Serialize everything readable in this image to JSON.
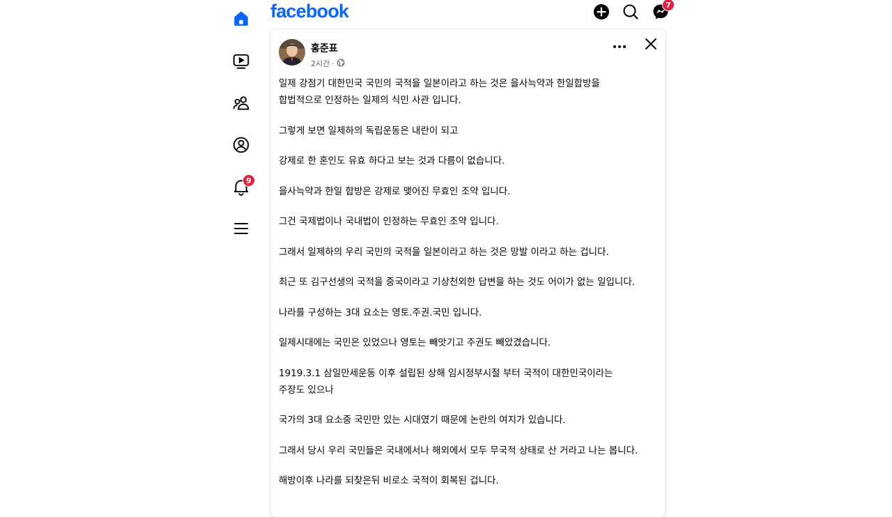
{
  "colors": {
    "brand": "#0866ff",
    "badge": "#e41e3f",
    "muted": "#65676b"
  },
  "topbar": {
    "logo": "facebook",
    "messenger_badge": "7",
    "icons": [
      "add-icon",
      "search-icon",
      "messenger-icon"
    ]
  },
  "rail": {
    "items": [
      {
        "icon": "home-icon",
        "active": true
      },
      {
        "icon": "video-icon",
        "active": false
      },
      {
        "icon": "friends-icon",
        "active": false
      },
      {
        "icon": "profile-icon",
        "active": false
      },
      {
        "icon": "bell-icon",
        "active": false,
        "badge": "9"
      },
      {
        "icon": "menu-icon",
        "active": false
      }
    ]
  },
  "post": {
    "author": "홍준표",
    "time": "2시간",
    "separator": "·",
    "audience_icon": "globe-icon",
    "paragraphs": [
      "일제 강점기 대한민국 국민의 국적을 일본이라고 하는 것은 을사늑약과 한일합방을\n합법적으로 인정하는 일제의 식민 사관 입니다.",
      "그렇게 보면 일제하의 독립운동은 내란이 되고",
      "강제로 한 혼인도  유효 하다고 보는 것과 다름이 없습니다.",
      "을사늑약과 한일 합방은 강제로 맺어진 무효인 조약 입니다.",
      "그건 국제법이나 국내법이 인정하는 무효인 조약 입니다.",
      "그래서 일제하의 우리 국민의 국적을 일본이라고 하는 것은 망발 이라고 하는 겁니다.",
      "최근 또 김구선생의 국적을 중국이라고 기상천외한 답변을 하는 것도 어이가 없는 일입니다.",
      "나라를 구성하는 3대 요소는 영토.주권.국민 입니다.",
      "일제시대에는 국민은 있었으나 영토는 빼앗기고 주권도 빼았겼습니다.",
      "1919.3.1 삼일만세운동 이후 설립된 상해 임시정부시절 부터 국적이 대한민국이라는\n주장도 있으나",
      "국가의 3대 요소중 국민만 있는 시대였기 때문에 논란의 여지가 있습니다.",
      "그래서  당시 우리 국민들은 국내에서나 해외에서 모두 무국적 상태로 산 거라고 나는 봅니다.",
      "해방이후 나라를 되찾은뒤 비로소 국적이 회복된 겁니다."
    ]
  }
}
